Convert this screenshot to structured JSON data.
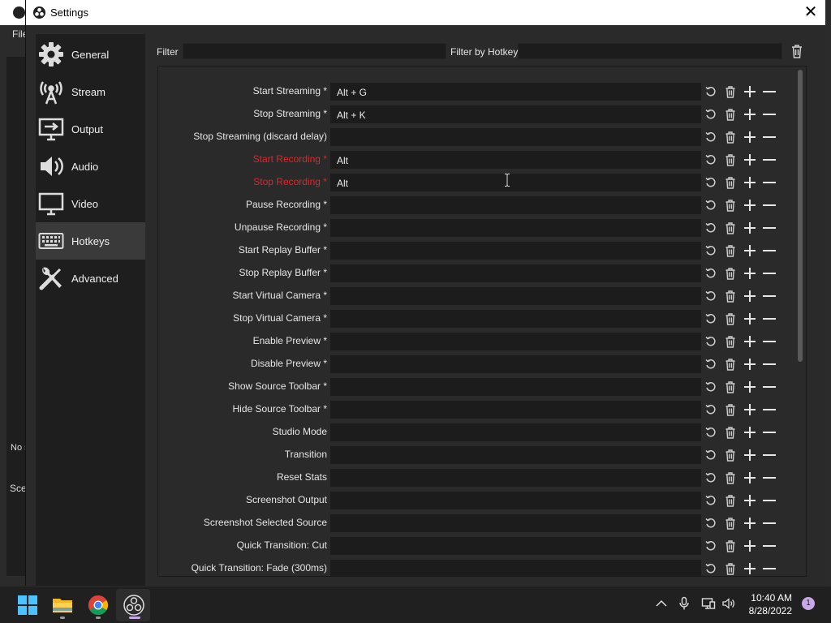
{
  "window": {
    "title": "Settings",
    "close_glyph": "✕"
  },
  "background_app": {
    "menu_file": "File",
    "no_source": "No s",
    "scenes_label": "Sce"
  },
  "sidebar": {
    "items": [
      {
        "label": "General",
        "icon": "gear-icon"
      },
      {
        "label": "Stream",
        "icon": "broadcast-tower-icon"
      },
      {
        "label": "Output",
        "icon": "output-monitor-icon"
      },
      {
        "label": "Audio",
        "icon": "speaker-icon"
      },
      {
        "label": "Video",
        "icon": "monitor-icon"
      },
      {
        "label": "Hotkeys",
        "icon": "keyboard-icon",
        "active": true
      },
      {
        "label": "Advanced",
        "icon": "tools-icon"
      }
    ]
  },
  "filters": {
    "filter_label": "Filter",
    "filter_value": "",
    "hotkey_filter_label": "Filter by Hotkey",
    "hotkey_filter_value": ""
  },
  "hotkeys": [
    {
      "label": "Start Streaming *",
      "value": "Alt + G",
      "conflict": false
    },
    {
      "label": "Stop Streaming *",
      "value": "Alt + K",
      "conflict": false
    },
    {
      "label": "Stop Streaming (discard delay)",
      "value": "",
      "conflict": false
    },
    {
      "label": "Start Recording *",
      "value": "Alt",
      "conflict": true
    },
    {
      "label": "Stop Recording *",
      "value": "Alt",
      "conflict": true
    },
    {
      "label": "Pause Recording *",
      "value": "",
      "conflict": false
    },
    {
      "label": "Unpause Recording *",
      "value": "",
      "conflict": false
    },
    {
      "label": "Start Replay Buffer *",
      "value": "",
      "conflict": false
    },
    {
      "label": "Stop Replay Buffer *",
      "value": "",
      "conflict": false
    },
    {
      "label": "Start Virtual Camera *",
      "value": "",
      "conflict": false
    },
    {
      "label": "Stop Virtual Camera *",
      "value": "",
      "conflict": false
    },
    {
      "label": "Enable Preview *",
      "value": "",
      "conflict": false
    },
    {
      "label": "Disable Preview *",
      "value": "",
      "conflict": false
    },
    {
      "label": "Show Source Toolbar *",
      "value": "",
      "conflict": false
    },
    {
      "label": "Hide Source Toolbar *",
      "value": "",
      "conflict": false
    },
    {
      "label": "Studio Mode",
      "value": "",
      "conflict": false
    },
    {
      "label": "Transition",
      "value": "",
      "conflict": false
    },
    {
      "label": "Reset Stats",
      "value": "",
      "conflict": false
    },
    {
      "label": "Screenshot Output",
      "value": "",
      "conflict": false
    },
    {
      "label": "Screenshot Selected Source",
      "value": "",
      "conflict": false
    },
    {
      "label": "Quick Transition: Cut",
      "value": "",
      "conflict": false
    },
    {
      "label": "Quick Transition: Fade (300ms)",
      "value": "",
      "conflict": false
    }
  ],
  "colors": {
    "conflict": "#e0252c",
    "accent": "#3a3a3a"
  },
  "taskbar": {
    "time": "10:40 AM",
    "date": "8/28/2022",
    "notification_count": "1",
    "apps": [
      "windows-start-icon",
      "file-explorer-icon",
      "chrome-icon",
      "obs-icon"
    ]
  }
}
